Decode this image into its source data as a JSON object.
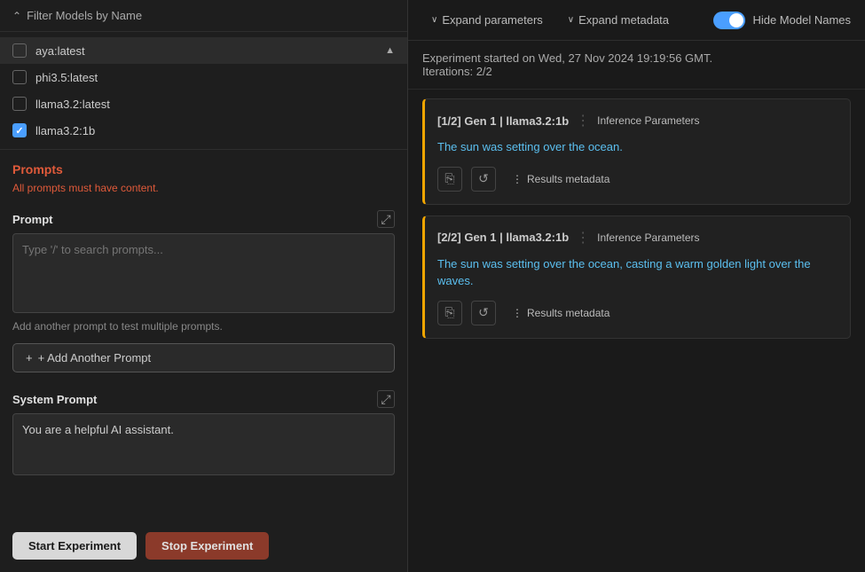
{
  "left": {
    "filter_label": "Filter Models by Name",
    "models": [
      {
        "id": "aya_latest",
        "name": "aya:latest",
        "checked": false
      },
      {
        "id": "phi35_latest",
        "name": "phi3.5:latest",
        "checked": false
      },
      {
        "id": "llama32_latest",
        "name": "llama3.2:latest",
        "checked": false
      },
      {
        "id": "llama32_1b",
        "name": "llama3.2:1b",
        "checked": true
      }
    ],
    "prompts_section": "Prompts",
    "prompts_error": "All prompts must have content.",
    "prompt_label": "Prompt",
    "prompt_placeholder": "Type '/' to search prompts...",
    "add_prompt_info": "Add another prompt to test multiple prompts.",
    "add_prompt_btn": "+ Add Another Prompt",
    "system_prompt_label": "System Prompt",
    "system_prompt_value": "You are a helpful AI assistant.",
    "btn_start": "Start Experiment",
    "btn_stop": "Stop Experiment"
  },
  "right": {
    "expand_params_label": "Expand parameters",
    "expand_metadata_label": "Expand metadata",
    "hide_model_names_label": "Hide Model Names",
    "experiment_info": "Experiment started on Wed, 27 Nov 2024 19:19:56 GMT.",
    "iterations": "Iterations: 2/2",
    "cards": [
      {
        "tag": "[1/2] Gen 1 | llama3.2:1b",
        "inference_label": "Inference Parameters",
        "text": "The sun was setting over the ocean.",
        "copy_icon": "⎘",
        "refresh_icon": "↺",
        "results_metadata_label": "Results metadata"
      },
      {
        "tag": "[2/2] Gen 1 | llama3.2:1b",
        "inference_label": "Inference Parameters",
        "text": "The sun was setting over the ocean, casting a warm golden light over the waves.",
        "copy_icon": "⎘",
        "refresh_icon": "↺",
        "results_metadata_label": "Results metadata"
      }
    ]
  }
}
